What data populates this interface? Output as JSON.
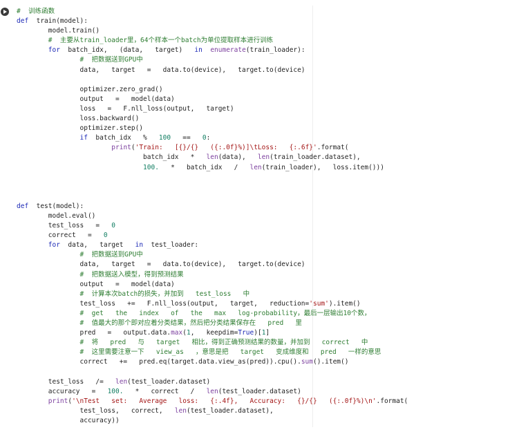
{
  "run_button": {
    "icon": "play-icon"
  },
  "code_lines": [
    [
      {
        "t": "#  训练函数",
        "c": "comment"
      }
    ],
    [
      {
        "t": "def",
        "c": "keyword"
      },
      {
        "t": "  train(model):",
        "c": "plain"
      }
    ],
    [
      {
        "t": "        model.train()",
        "c": "plain"
      }
    ],
    [
      {
        "t": "        ",
        "c": "plain"
      },
      {
        "t": "#  主要从train_loader里，64个样本一个batch为单位提取样本进行训练",
        "c": "comment"
      }
    ],
    [
      {
        "t": "        ",
        "c": "plain"
      },
      {
        "t": "for",
        "c": "keyword"
      },
      {
        "t": "  batch_idx,   (data,   target)   ",
        "c": "plain"
      },
      {
        "t": "in",
        "c": "keyword"
      },
      {
        "t": "  ",
        "c": "plain"
      },
      {
        "t": "enumerate",
        "c": "builtin"
      },
      {
        "t": "(train_loader):",
        "c": "plain"
      }
    ],
    [
      {
        "t": "                ",
        "c": "plain"
      },
      {
        "t": "#  把数据送到GPU中",
        "c": "comment"
      }
    ],
    [
      {
        "t": "                data,   target   =   data.to(device),   target.to(device)",
        "c": "plain"
      }
    ],
    [
      {
        "t": "",
        "c": "plain"
      }
    ],
    [
      {
        "t": "                optimizer.zero_grad()",
        "c": "plain"
      }
    ],
    [
      {
        "t": "                output   =   model(data)",
        "c": "plain"
      }
    ],
    [
      {
        "t": "                loss   =   F.nll_loss(output,   target)",
        "c": "plain"
      }
    ],
    [
      {
        "t": "                loss.backward()",
        "c": "plain"
      }
    ],
    [
      {
        "t": "                optimizer.step()",
        "c": "plain"
      }
    ],
    [
      {
        "t": "                ",
        "c": "plain"
      },
      {
        "t": "if",
        "c": "keyword"
      },
      {
        "t": "  batch_idx   %   ",
        "c": "plain"
      },
      {
        "t": "100",
        "c": "number"
      },
      {
        "t": "   ==   ",
        "c": "plain"
      },
      {
        "t": "0",
        "c": "number"
      },
      {
        "t": ":",
        "c": "plain"
      }
    ],
    [
      {
        "t": "                        ",
        "c": "plain"
      },
      {
        "t": "print",
        "c": "builtin"
      },
      {
        "t": "(",
        "c": "plain"
      },
      {
        "t": "'Train:   [{}/{}   ({:.0f}%)]\\tLoss:   {:.6f}'",
        "c": "string"
      },
      {
        "t": ".format(",
        "c": "plain"
      }
    ],
    [
      {
        "t": "                                batch_idx   *   ",
        "c": "plain"
      },
      {
        "t": "len",
        "c": "builtin"
      },
      {
        "t": "(data),   ",
        "c": "plain"
      },
      {
        "t": "len",
        "c": "builtin"
      },
      {
        "t": "(train_loader.dataset),",
        "c": "plain"
      }
    ],
    [
      {
        "t": "                                ",
        "c": "plain"
      },
      {
        "t": "100.",
        "c": "number"
      },
      {
        "t": "   *   batch_idx   /   ",
        "c": "plain"
      },
      {
        "t": "len",
        "c": "builtin"
      },
      {
        "t": "(train_loader),   loss.item()))",
        "c": "plain"
      }
    ],
    [
      {
        "t": "",
        "c": "plain"
      }
    ],
    [
      {
        "t": "",
        "c": "plain"
      }
    ],
    [
      {
        "t": "",
        "c": "plain"
      }
    ],
    [
      {
        "t": "def",
        "c": "keyword"
      },
      {
        "t": "  test(model):",
        "c": "plain"
      }
    ],
    [
      {
        "t": "        model.eval()",
        "c": "plain"
      }
    ],
    [
      {
        "t": "        test_loss   =   ",
        "c": "plain"
      },
      {
        "t": "0",
        "c": "number"
      }
    ],
    [
      {
        "t": "        correct   =   ",
        "c": "plain"
      },
      {
        "t": "0",
        "c": "number"
      }
    ],
    [
      {
        "t": "        ",
        "c": "plain"
      },
      {
        "t": "for",
        "c": "keyword"
      },
      {
        "t": "  data,   target   ",
        "c": "plain"
      },
      {
        "t": "in",
        "c": "keyword"
      },
      {
        "t": "  test_loader:",
        "c": "plain"
      }
    ],
    [
      {
        "t": "                ",
        "c": "plain"
      },
      {
        "t": "#  把数据送到GPU中",
        "c": "comment"
      }
    ],
    [
      {
        "t": "                data,   target   =   data.to(device),   target.to(device)",
        "c": "plain"
      }
    ],
    [
      {
        "t": "                ",
        "c": "plain"
      },
      {
        "t": "#  把数据送入模型，得到预测结果",
        "c": "comment"
      }
    ],
    [
      {
        "t": "                output   =   model(data)",
        "c": "plain"
      }
    ],
    [
      {
        "t": "                ",
        "c": "plain"
      },
      {
        "t": "#  计算本次batch的损失，并加到   test_loss   中",
        "c": "comment"
      }
    ],
    [
      {
        "t": "                test_loss   +=   F.nll_loss(output,   target,   reduction=",
        "c": "plain"
      },
      {
        "t": "'sum'",
        "c": "string"
      },
      {
        "t": ").item()",
        "c": "plain"
      }
    ],
    [
      {
        "t": "                ",
        "c": "plain"
      },
      {
        "t": "#  get   the   index   of   the   max   log-probability，最后一层输出10个数，",
        "c": "comment"
      }
    ],
    [
      {
        "t": "                ",
        "c": "plain"
      },
      {
        "t": "#  值最大的那个即对应着分类结果，然后把分类结果保存在   pred   里",
        "c": "comment"
      }
    ],
    [
      {
        "t": "                pred   =   output.data.",
        "c": "plain"
      },
      {
        "t": "max",
        "c": "builtin"
      },
      {
        "t": "(",
        "c": "plain"
      },
      {
        "t": "1",
        "c": "number"
      },
      {
        "t": ",   keepdim=",
        "c": "plain"
      },
      {
        "t": "True",
        "c": "keyword"
      },
      {
        "t": ")[",
        "c": "plain"
      },
      {
        "t": "1",
        "c": "number"
      },
      {
        "t": "]",
        "c": "plain"
      }
    ],
    [
      {
        "t": "                ",
        "c": "plain"
      },
      {
        "t": "#  将   pred   与   target   相比，得到正确预测结果的数量，并加到   correct   中",
        "c": "comment"
      }
    ],
    [
      {
        "t": "                ",
        "c": "plain"
      },
      {
        "t": "#  这里需要注意一下   view_as   ，意思是把   target   变成维度和   pred   一样的意思",
        "c": "comment"
      }
    ],
    [
      {
        "t": "                correct   +=   pred.eq(target.data.view_as(pred)).cpu().",
        "c": "plain"
      },
      {
        "t": "sum",
        "c": "builtin"
      },
      {
        "t": "().item()",
        "c": "plain"
      }
    ],
    [
      {
        "t": "",
        "c": "plain"
      }
    ],
    [
      {
        "t": "        test_loss   /=   ",
        "c": "plain"
      },
      {
        "t": "len",
        "c": "builtin"
      },
      {
        "t": "(test_loader.dataset)",
        "c": "plain"
      }
    ],
    [
      {
        "t": "        accuracy   =   ",
        "c": "plain"
      },
      {
        "t": "100.",
        "c": "number"
      },
      {
        "t": "   *   correct   /   ",
        "c": "plain"
      },
      {
        "t": "len",
        "c": "builtin"
      },
      {
        "t": "(test_loader.dataset)",
        "c": "plain"
      }
    ],
    [
      {
        "t": "        ",
        "c": "plain"
      },
      {
        "t": "print",
        "c": "builtin"
      },
      {
        "t": "(",
        "c": "plain"
      },
      {
        "t": "'\\nTest   set:   Average   loss:   {:.4f},   Accuracy:   {}/{}   ({:.0f}%)\\n'",
        "c": "string"
      },
      {
        "t": ".format(",
        "c": "plain"
      }
    ],
    [
      {
        "t": "                test_loss,   correct,   ",
        "c": "plain"
      },
      {
        "t": "len",
        "c": "builtin"
      },
      {
        "t": "(test_loader.dataset),",
        "c": "plain"
      }
    ],
    [
      {
        "t": "                accuracy))",
        "c": "plain"
      }
    ]
  ]
}
